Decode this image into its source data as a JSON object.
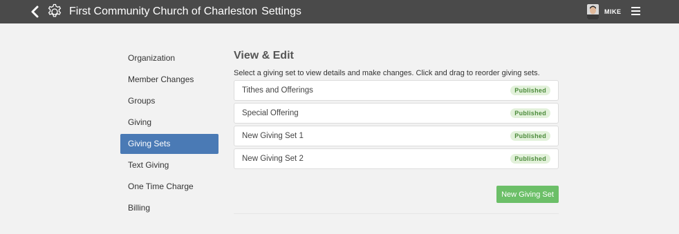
{
  "header": {
    "org_name": "First Community Church of Charleston",
    "section": "Settings",
    "user_name": "MIKE",
    "back_icon": "chevron-left-icon",
    "settings_icon": "gear-icon",
    "menu_icon": "hamburger-menu-icon"
  },
  "sidebar": {
    "items": [
      {
        "label": "Organization"
      },
      {
        "label": "Member Changes"
      },
      {
        "label": "Groups"
      },
      {
        "label": "Giving"
      },
      {
        "label": "Giving Sets"
      },
      {
        "label": "Text Giving"
      },
      {
        "label": "One Time Charge"
      },
      {
        "label": "Billing"
      }
    ],
    "active": "Giving Sets"
  },
  "main": {
    "title": "View & Edit",
    "description": "Select a giving set to view details and make changes. Click and drag to reorder giving sets.",
    "giving_sets": [
      {
        "name": "Tithes and Offerings",
        "status": "Published"
      },
      {
        "name": "Special Offering",
        "status": "Published"
      },
      {
        "name": "New Giving Set 1",
        "status": "Published"
      },
      {
        "name": "New Giving Set 2",
        "status": "Published"
      }
    ],
    "new_button_label": "New Giving Set"
  },
  "colors": {
    "header_bg": "#4a4a4a",
    "active_nav": "#4a7ab5",
    "primary_button": "#6cbf68",
    "badge_bg": "#e2f1da",
    "badge_text": "#4b8a3a"
  }
}
